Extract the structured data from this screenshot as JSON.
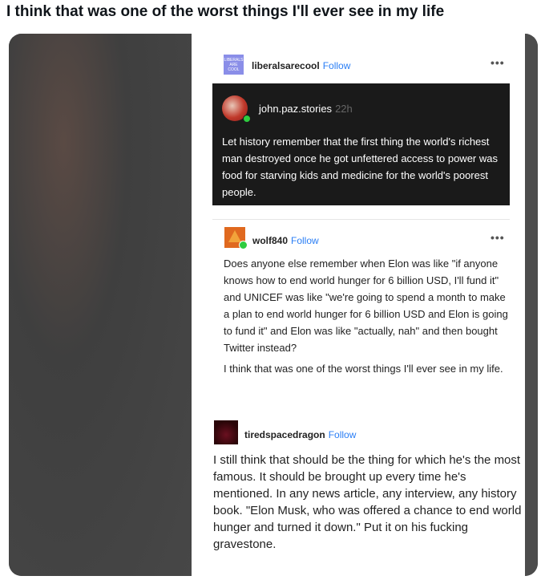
{
  "tweet": {
    "text": "I think that was one of the worst things I'll ever see in my life"
  },
  "post": {
    "author": "liberalsarecool",
    "author_avatar_text": "LIBERALS ARE COOL",
    "follow_label": "Follow",
    "menu_icon": "ellipsis-icon",
    "reblog1": {
      "author": "john.paz.stories",
      "time": "22h",
      "text": "Let history remember that the first thing the world's richest man destroyed once he got unfettered access to power was food for starving kids and medicine for the world's poorest people."
    },
    "reblog2": {
      "author": "wolf840",
      "follow_label": "Follow",
      "paragraph1": "Does anyone else remember when Elon was like \"if anyone knows how to end world hunger for 6 billion USD, I'll fund it\" and UNICEF was like \"we're going to spend a month to make a plan to end world hunger for 6 billion USD and Elon is going to fund it\" and Elon was like \"actually, nah\" and then bought Twitter instead?",
      "paragraph2": "I think that was one of the worst things I'll ever see in my life."
    },
    "reblog3": {
      "author": "tiredspacedragon",
      "follow_label": "Follow",
      "text": "I still think that should be the thing for which he's the most famous. It should be brought up every time he's mentioned. In any news article, any interview, any history book. \"Elon Musk, who was offered a chance to end world hunger and turned it down.\" Put it on his fucking gravestone."
    }
  },
  "colors": {
    "follow": "#2a7ef5",
    "dark_box": "#1a1a1a",
    "online": "#2ecc40"
  }
}
